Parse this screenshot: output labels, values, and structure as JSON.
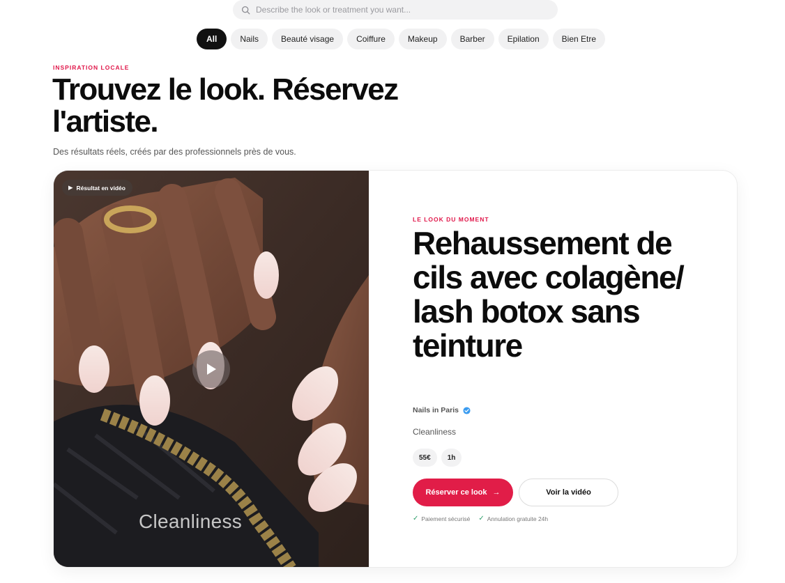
{
  "search": {
    "placeholder": "Describe the look or treatment you want..."
  },
  "categories": [
    {
      "label": "All",
      "active": true
    },
    {
      "label": "Nails"
    },
    {
      "label": "Beauté visage"
    },
    {
      "label": "Coiffure"
    },
    {
      "label": "Makeup"
    },
    {
      "label": "Barber"
    },
    {
      "label": "Epilation"
    },
    {
      "label": "Bien Etre"
    }
  ],
  "hero": {
    "eyebrow": "INSPIRATION LOCALE",
    "headline": "Trouvez le look. Réservez l'artiste.",
    "subtitle": "Des résultats réels, créés par des professionnels près de vous."
  },
  "featured": {
    "video_badge": "Résultat en vidéo",
    "overlay_text": "Cleanliness",
    "eyebrow": "LE LOOK DU MOMENT",
    "title": "Rehaussement de cils avec colagène/ lash botox sans teinture",
    "artist": "Nails in Paris",
    "service": "Cleanliness",
    "price": "55€",
    "duration": "1h",
    "book_label": "Réserver ce look",
    "book_arrow": "→",
    "video_label": "Voir la vidéo",
    "assurances": [
      "Paiement sécurisé",
      "Annulation gratuite 24h"
    ]
  },
  "colors": {
    "accent": "#e11d48",
    "eyebrow": "#e0174a",
    "verified": "#3b9cf0"
  },
  "icons": {
    "search": "search-icon",
    "play": "play-icon",
    "verified": "verified-badge-icon",
    "check": "check-icon"
  }
}
